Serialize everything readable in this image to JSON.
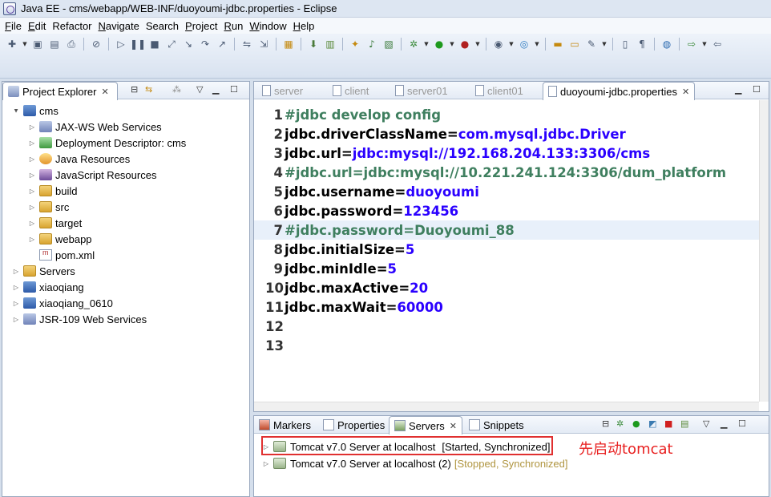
{
  "window": {
    "title": "Java EE - cms/webapp/WEB-INF/duoyoumi-jdbc.properties - Eclipse"
  },
  "menubar": [
    {
      "mnemonic": "F",
      "rest": "ile"
    },
    {
      "mnemonic": "E",
      "rest": "dit"
    },
    {
      "mnemonic": "",
      "rest": "Refactor"
    },
    {
      "mnemonic": "N",
      "rest": "avigate"
    },
    {
      "mnemonic": "",
      "rest": "Search"
    },
    {
      "mnemonic": "P",
      "rest": "roject"
    },
    {
      "mnemonic": "R",
      "rest": "un"
    },
    {
      "mnemonic": "W",
      "rest": "indow"
    },
    {
      "mnemonic": "H",
      "rest": "elp"
    }
  ],
  "explorer": {
    "tab_label": "Project Explorer",
    "tree": [
      {
        "label": "cms",
        "icon": "project-icon",
        "expanded": true
      },
      {
        "label": "JAX-WS Web Services",
        "icon": "web-services-icon"
      },
      {
        "label": "Deployment Descriptor: cms",
        "icon": "deployment-descriptor-icon"
      },
      {
        "label": "Java Resources",
        "icon": "java-resources-icon"
      },
      {
        "label": "JavaScript Resources",
        "icon": "javascript-resources-icon"
      },
      {
        "label": "build",
        "icon": "folder-icon"
      },
      {
        "label": "src",
        "icon": "folder-icon"
      },
      {
        "label": "target",
        "icon": "folder-icon"
      },
      {
        "label": "webapp",
        "icon": "folder-icon"
      },
      {
        "label": "pom.xml",
        "icon": "xml-file-icon"
      },
      {
        "label": "Servers",
        "icon": "folder-icon"
      },
      {
        "label": "xiaoqiang",
        "icon": "project-icon"
      },
      {
        "label": "xiaoqiang_0610",
        "icon": "project-icon"
      },
      {
        "label": "JSR-109 Web Services",
        "icon": "web-services-icon"
      }
    ]
  },
  "editor": {
    "tabs": [
      {
        "label": "server",
        "active": false
      },
      {
        "label": "client",
        "active": false
      },
      {
        "label": "server01",
        "active": false
      },
      {
        "label": "client01",
        "active": false
      },
      {
        "label": "duoyoumi-jdbc.properties",
        "active": true
      }
    ],
    "lines": [
      {
        "n": "1",
        "key": "",
        "val": "",
        "comment": "#jdbc develop config"
      },
      {
        "n": "2",
        "key": "jdbc.driverClassName=",
        "val": "com.mysql.jdbc.Driver",
        "comment": ""
      },
      {
        "n": "3",
        "key": "jdbc.url=",
        "val": "jdbc:mysql://192.168.204.133:3306/cms",
        "comment": ""
      },
      {
        "n": "4",
        "key": "",
        "val": "",
        "comment": "#jdbc.url=jdbc:mysql://10.221.241.124:3306/dum_platform"
      },
      {
        "n": "5",
        "key": "jdbc.username=",
        "val": "duoyoumi",
        "comment": ""
      },
      {
        "n": "6",
        "key": "jdbc.password=",
        "val": "123456",
        "comment": ""
      },
      {
        "n": "7",
        "key": "",
        "val": "",
        "comment": "#jdbc.password=Duoyoumi_88"
      },
      {
        "n": "8",
        "key": "jdbc.initialSize=",
        "val": "5",
        "comment": ""
      },
      {
        "n": "9",
        "key": "jdbc.minIdle=",
        "val": "5",
        "comment": ""
      },
      {
        "n": "10",
        "key": "jdbc.maxActive=",
        "val": "20",
        "comment": ""
      },
      {
        "n": "11",
        "key": "jdbc.maxWait=",
        "val": "60000",
        "comment": ""
      },
      {
        "n": "12",
        "key": "",
        "val": "",
        "comment": ""
      },
      {
        "n": "13",
        "key": "",
        "val": "",
        "comment": ""
      }
    ]
  },
  "bottom_panel": {
    "tabs": [
      {
        "label": "Markers"
      },
      {
        "label": "Properties"
      },
      {
        "label": "Servers"
      },
      {
        "label": "Snippets"
      }
    ],
    "servers": [
      {
        "name": "Tomcat v7.0 Server at localhost",
        "status": "[Started, Synchronized]"
      },
      {
        "name": "Tomcat v7.0 Server at localhost (2)",
        "status": "[Stopped, Synchronized]"
      }
    ]
  },
  "annotation": {
    "text": "先启动tomcat",
    "color": "#e82020"
  },
  "colors": {
    "keyword": "#000000",
    "value": "#2a00ff",
    "comment": "#3f7f5f",
    "highlight": "#e8f0fa"
  }
}
